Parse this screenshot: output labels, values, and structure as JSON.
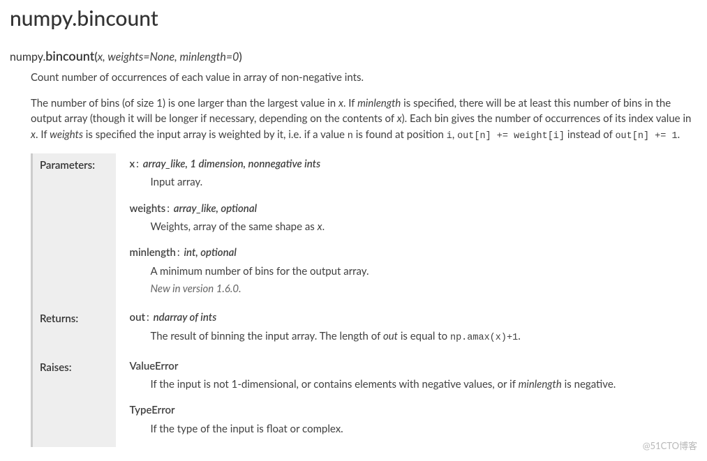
{
  "title": "numpy.bincount",
  "signature": {
    "module": "numpy.",
    "name": "bincount",
    "params": "x, weights=None, minlength=0"
  },
  "summary": "Count number of occurrences of each value in array of non-negative ints.",
  "description": {
    "p1": "The number of bins (of size 1) is one larger than the largest value in ",
    "px": "x",
    "p2": ". If ",
    "pmin": "minlength",
    "p3": " is specified, there will be at least this number of bins in the output array (though it will be longer if necessary, depending on the contents of ",
    "px2": "x",
    "p4": "). Each bin gives the number of occurrences of its index value in ",
    "px3": "x",
    "p5": ". If ",
    "pweights": "weights",
    "p6": " is specified the input array is weighted by it, i.e. if a value ",
    "cn": "n",
    "p7": " is found at position ",
    "ci": "i",
    "p8": ", ",
    "cexpr1": "out[n] += weight[i]",
    "p9": " instead of ",
    "cexpr2": "out[n] += 1",
    "p10": "."
  },
  "fields": {
    "parameters": {
      "label": "Parameters:",
      "items": [
        {
          "name": "x",
          "type": "array_like, 1 dimension, nonnegative ints",
          "desc": "Input array."
        },
        {
          "name": "weights",
          "type": "array_like, optional",
          "desc_pre": "Weights, array of the same shape as ",
          "desc_em": "x",
          "desc_post": "."
        },
        {
          "name": "minlength",
          "type": "int, optional",
          "desc": "A minimum number of bins for the output array.",
          "version": "New in version 1.6.0."
        }
      ]
    },
    "returns": {
      "label": "Returns:",
      "name": "out",
      "type": "ndarray of ints",
      "desc_pre": "The result of binning the input array. The length of ",
      "desc_em": "out",
      "desc_mid": " is equal to ",
      "desc_code": "np.amax(x)+1",
      "desc_post": "."
    },
    "raises": {
      "label": "Raises:",
      "items": [
        {
          "name": "ValueError",
          "desc_pre": "If the input is not 1-dimensional, or contains elements with negative values, or if ",
          "desc_em": "minlength",
          "desc_post": " is negative."
        },
        {
          "name": "TypeError",
          "desc": "If the type of the input is float or complex."
        }
      ]
    }
  },
  "watermark": "@51CTO博客"
}
